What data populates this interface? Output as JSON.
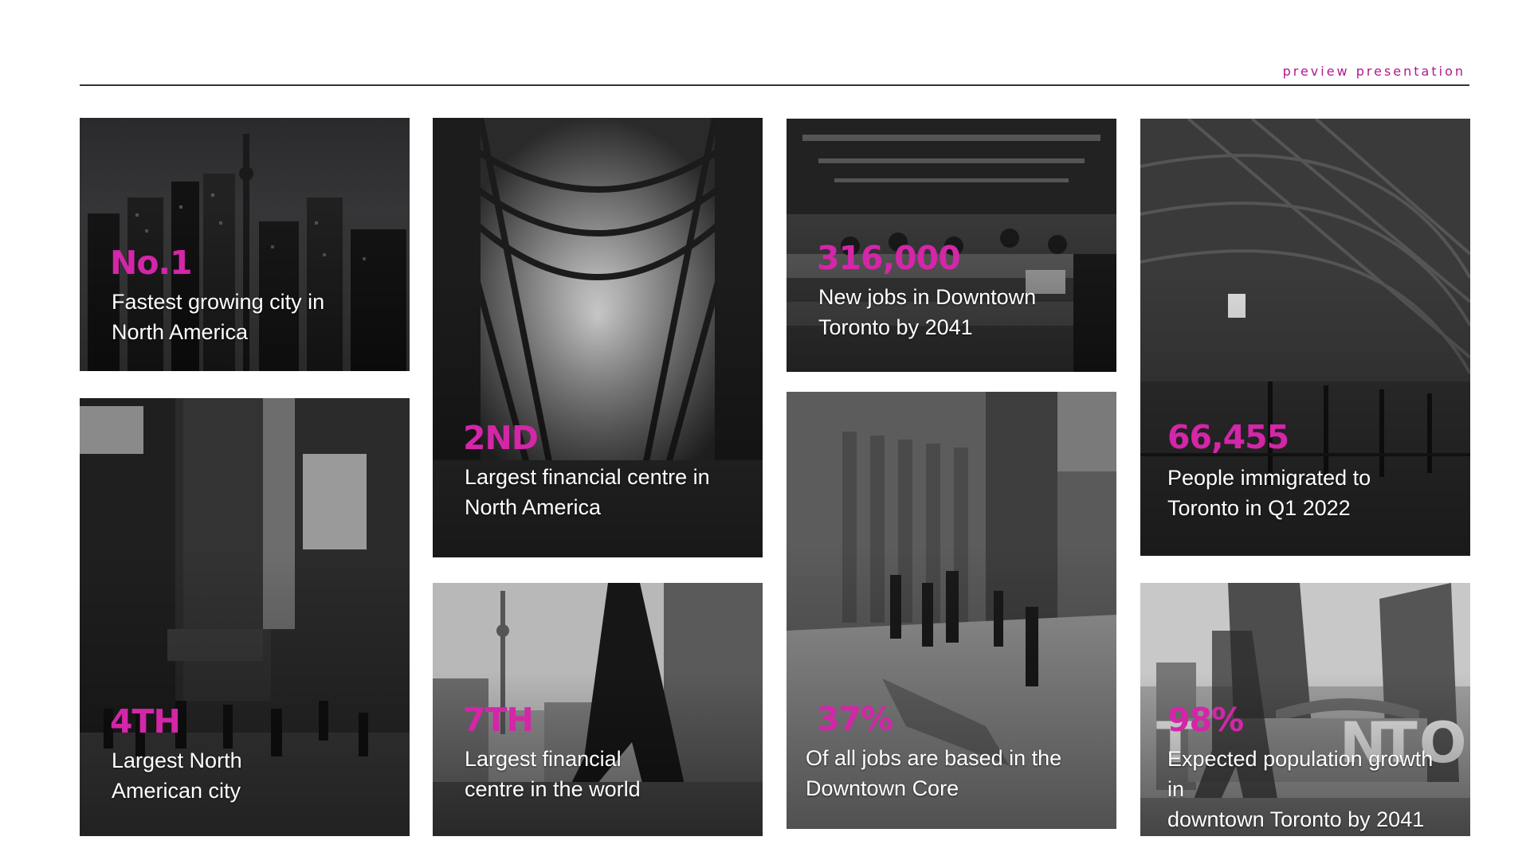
{
  "header": {
    "label": "preview presentation"
  },
  "colors": {
    "accent": "#d326a8",
    "header_label": "#b1188c",
    "rule": "#333333",
    "card_text": "#ffffff"
  },
  "cards": [
    {
      "stat": "No.1",
      "text_line1": "Fastest growing city in",
      "text_line2": "North America",
      "photo": "toronto-skyline-night-image"
    },
    {
      "stat": "4TH",
      "text_line1": "Largest North",
      "text_line2": "American city",
      "photo": "yonge-dundas-square-image"
    },
    {
      "stat": "2ND",
      "text_line1": "Largest financial centre in",
      "text_line2": "North America",
      "photo": "brookfield-place-galleria-image"
    },
    {
      "stat": "7TH",
      "text_line1": "Largest financial",
      "text_line2": "centre in the world",
      "photo": "walking-commuter-cn-tower-image"
    },
    {
      "stat": "316,000",
      "text_line1": "New jobs in Downtown",
      "text_line2": "Toronto by 2041",
      "photo": "open-office-workers-image"
    },
    {
      "stat": "37%",
      "text_line1": "Of all jobs are based in the",
      "text_line2": "Downtown Core",
      "photo": "union-station-street-image"
    },
    {
      "stat": "66,455",
      "text_line1": "People immigrated to",
      "text_line2": "Toronto in Q1 2022",
      "photo": "airport-terminal-hall-image"
    },
    {
      "stat": "98%",
      "text_line1": "Expected population growth in",
      "text_line2": "downtown Toronto by 2041",
      "photo": "nathan-phillips-square-image"
    }
  ]
}
